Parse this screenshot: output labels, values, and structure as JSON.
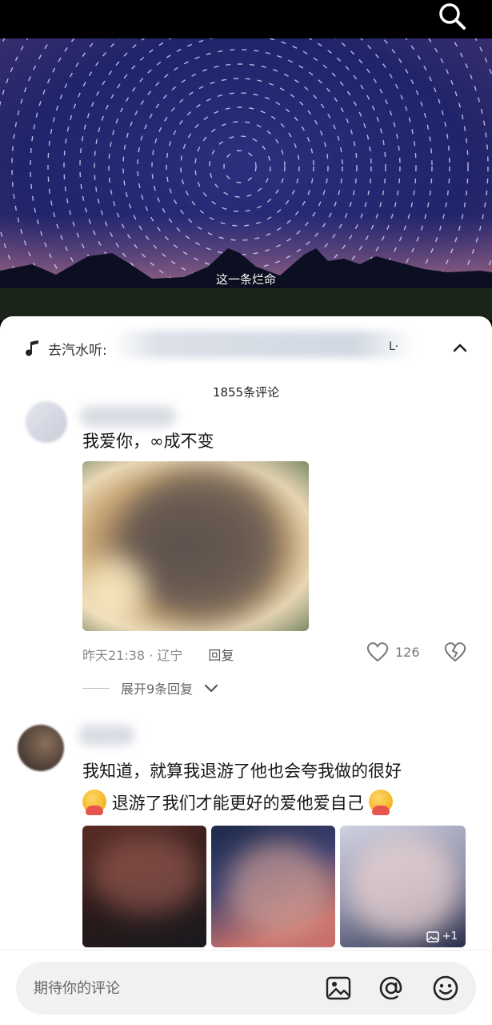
{
  "header": {
    "search_icon": "search-icon"
  },
  "video": {
    "caption": "这一条烂命"
  },
  "sheet": {
    "music_label": "去汽水听:",
    "music_extra": "L·",
    "comment_count": "1855条评论"
  },
  "comments": [
    {
      "text": "我爱你，∞成不变",
      "meta_time_location": "昨天21:38 · 辽宁",
      "reply_label": "回复",
      "likes": "126",
      "expand_label": "展开9条回复"
    },
    {
      "text_line1": "我知道，就算我退游了他也会夸我做的很好",
      "text_line2": "退游了我们才能更好的爱他爱自己",
      "more_images_badge": "+1"
    }
  ],
  "input": {
    "placeholder": "期待你的评论"
  },
  "colors": {
    "background": "#ffffff",
    "input_bg": "#f1f1f2",
    "muted": "#8a8a8a"
  }
}
